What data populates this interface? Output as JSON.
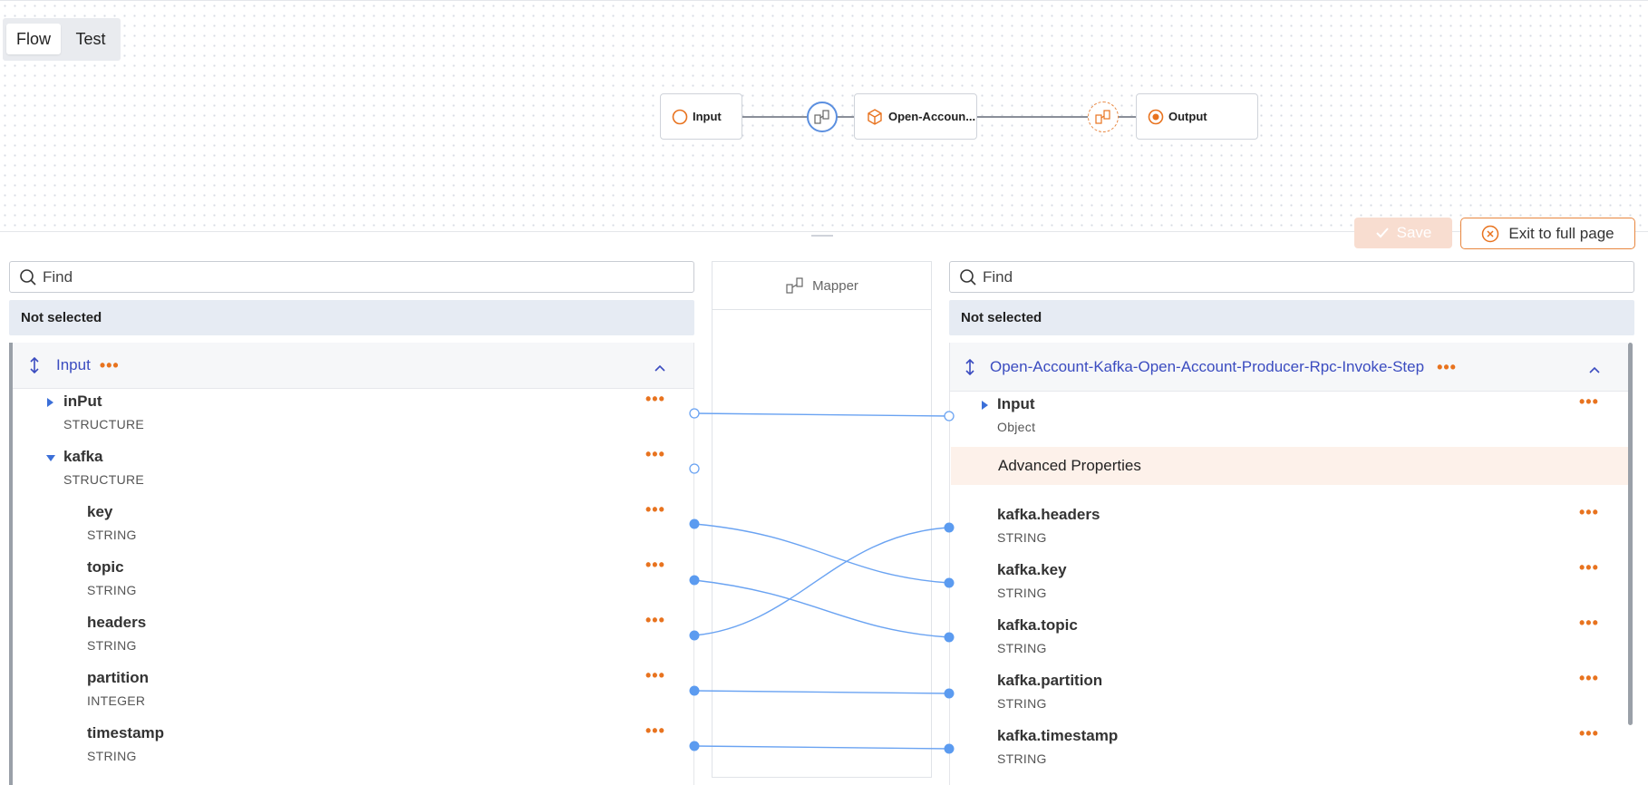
{
  "tabs": {
    "flow": "Flow",
    "test": "Test"
  },
  "flow_nodes": {
    "input": "Input",
    "step": "Open-Accoun...",
    "output": "Output"
  },
  "actions": {
    "save": "Save",
    "exit": "Exit to full page"
  },
  "mapper": {
    "label": "Mapper"
  },
  "left": {
    "find_placeholder": "Find",
    "selection": "Not selected",
    "header_title": "Input",
    "rows": [
      {
        "name": "inPut",
        "type": "STRUCTURE"
      },
      {
        "name": "kafka",
        "type": "STRUCTURE"
      },
      {
        "name": "key",
        "type": "STRING"
      },
      {
        "name": "topic",
        "type": "STRING"
      },
      {
        "name": "headers",
        "type": "STRING"
      },
      {
        "name": "partition",
        "type": "INTEGER"
      },
      {
        "name": "timestamp",
        "type": "STRING"
      }
    ]
  },
  "right": {
    "find_placeholder": "Find",
    "selection": "Not selected",
    "header_title": "Open-Account-Kafka-Open-Account-Producer-Rpc-Invoke-Step",
    "input_row": {
      "name": "Input",
      "type": "Object"
    },
    "advanced": "Advanced Properties",
    "rows": [
      {
        "name": "kafka.headers",
        "type": "STRING"
      },
      {
        "name": "kafka.key",
        "type": "STRING"
      },
      {
        "name": "kafka.topic",
        "type": "STRING"
      },
      {
        "name": "kafka.partition",
        "type": "STRING"
      },
      {
        "name": "kafka.timestamp",
        "type": "STRING"
      }
    ]
  },
  "colors": {
    "accent": "#e8731f",
    "link": "#5b9bf0",
    "title": "#3b4cc0"
  }
}
